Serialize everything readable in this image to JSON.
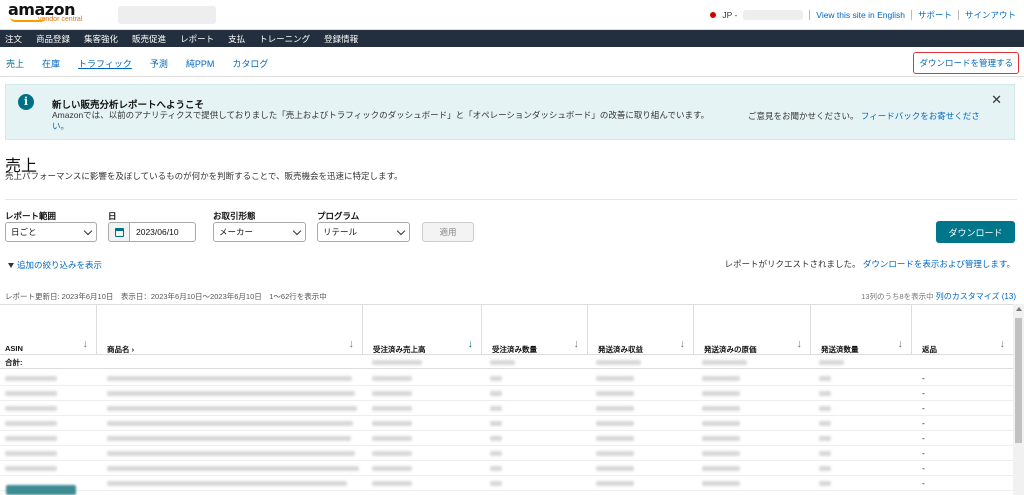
{
  "app": {
    "logo_text": "amazon",
    "logo_sub": "vendor central"
  },
  "topbar": {
    "region": "JP -",
    "links": [
      "View this site in English",
      "サポート",
      "サインアウト"
    ]
  },
  "nav": {
    "items": [
      "注文",
      "商品登録",
      "集客強化",
      "販売促進",
      "レポート",
      "支払",
      "トレーニング",
      "登録情報"
    ]
  },
  "subnav": {
    "tabs": [
      "売上",
      "在庫",
      "トラフィック",
      "予測",
      "純PPM",
      "カタログ"
    ],
    "manage_downloads": "ダウンロードを管理する"
  },
  "banner": {
    "title": "新しい販売分析レポートへようこそ",
    "message_line1": "Amazonでは、以前のアナリティクスで提供しておりました「売上およびトラフィックのダッシュボード」と「オペレーションダッシュボード」の改善に取り組んでいます。",
    "message_line2": "い。",
    "feedback_prefix": "ご意見をお聞かせください。",
    "feedback_link": "フィードバックをお寄せくださ",
    "close": "✕"
  },
  "page": {
    "title": "売上",
    "subtitle": "売上パフォーマンスに影響を及ぼしているものが何かを判断することで、販売機会を迅速に特定します。"
  },
  "filters": {
    "report_range_label": "レポート範囲",
    "report_range_value": "日ごと",
    "date_label": "日",
    "date_value": "2023/06/10",
    "transaction_label": "お取引形態",
    "transaction_value": "メーカー",
    "program_label": "プログラム",
    "program_value": "リテール",
    "apply": "適用",
    "download": "ダウンロード",
    "add_filter": "追加の絞り込みを表示",
    "request_msg": "レポートがリクエストされました。",
    "request_link": "ダウンロードを表示および管理します。"
  },
  "meta": {
    "updated": "レポート更新日: 2023年6月10日　表示日：2023年6月10日～2023年6月10日　1～62行を表示中",
    "cols_info": "13列のうち8を表示中",
    "customize": "列のカスタマイズ (13)"
  },
  "table": {
    "columns": [
      "ASIN",
      "商品名 ›",
      "受注済み売上高",
      "受注済み数量",
      "発送済み収益",
      "発送済みの原価",
      "発送済数量",
      "返品"
    ],
    "total_label": "合計:",
    "returns_value": "-"
  }
}
